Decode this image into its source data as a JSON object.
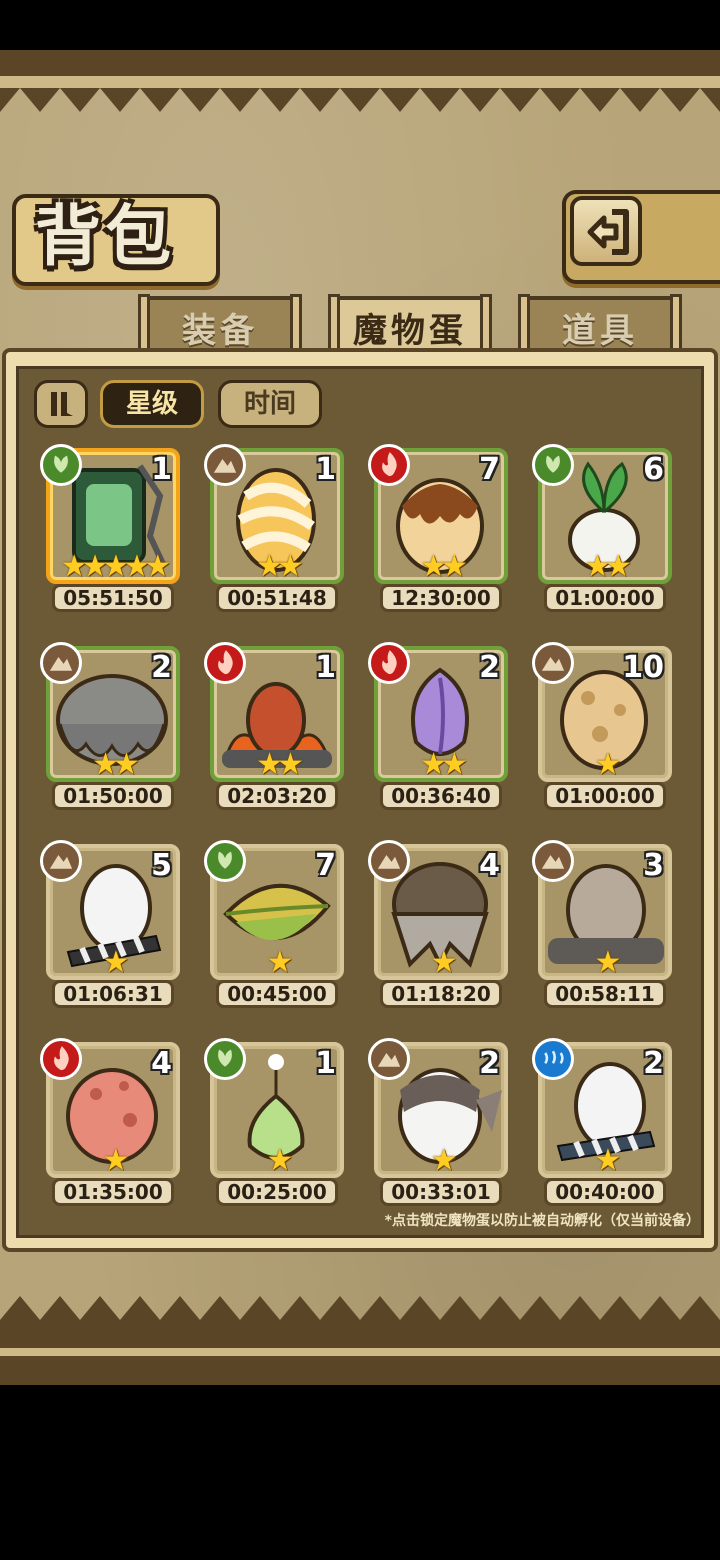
{
  "title": "背包",
  "tabs": [
    {
      "label": "装备",
      "active": false
    },
    {
      "label": "魔物蛋",
      "active": true
    },
    {
      "label": "道具",
      "active": false
    }
  ],
  "sort": {
    "toggle_icon": "pause-sort-icon",
    "star_label": "星级",
    "time_label": "时间",
    "active": "star"
  },
  "colors": {
    "grass": "#4a8a2a",
    "earth": "#7a5a3a",
    "fire": "#c41a1a",
    "water": "#1a7ad0",
    "star": "#ffcc22"
  },
  "eggs": [
    {
      "element": "grass",
      "count": "1",
      "stars": 5,
      "timer": "05:51:50",
      "art": "caged-green-egg",
      "selected": true
    },
    {
      "element": "earth",
      "count": "1",
      "stars": 2,
      "timer": "00:51:48",
      "art": "bandaged-egg"
    },
    {
      "element": "fire",
      "count": "7",
      "stars": 2,
      "timer": "12:30:00",
      "art": "caramel-slime-egg"
    },
    {
      "element": "grass",
      "count": "6",
      "stars": 2,
      "timer": "01:00:00",
      "art": "radish-egg"
    },
    {
      "element": "earth",
      "count": "2",
      "stars": 2,
      "timer": "01:50:00",
      "art": "gray-fur-egg"
    },
    {
      "element": "fire",
      "count": "1",
      "stars": 2,
      "timer": "02:03:20",
      "art": "flame-egg"
    },
    {
      "element": "fire",
      "count": "2",
      "stars": 2,
      "timer": "00:36:40",
      "art": "purple-bud-egg"
    },
    {
      "element": "earth",
      "count": "10",
      "stars": 1,
      "timer": "01:00:00",
      "art": "spotted-slime-egg",
      "plain": true
    },
    {
      "element": "earth",
      "count": "5",
      "stars": 1,
      "timer": "01:06:31",
      "art": "striped-tail-egg",
      "plain": true
    },
    {
      "element": "grass",
      "count": "7",
      "stars": 1,
      "timer": "00:45:00",
      "art": "leaf-egg",
      "plain": true
    },
    {
      "element": "earth",
      "count": "4",
      "stars": 1,
      "timer": "01:18:20",
      "art": "iron-mask-egg",
      "plain": true
    },
    {
      "element": "earth",
      "count": "3",
      "stars": 1,
      "timer": "00:58:11",
      "art": "rock-egg",
      "plain": true
    },
    {
      "element": "fire",
      "count": "4",
      "stars": 1,
      "timer": "01:35:00",
      "art": "pink-slime-egg",
      "plain": true
    },
    {
      "element": "grass",
      "count": "1",
      "stars": 1,
      "timer": "00:25:00",
      "art": "sprout-egg",
      "plain": true
    },
    {
      "element": "earth",
      "count": "2",
      "stars": 1,
      "timer": "00:33:01",
      "art": "bat-egg",
      "plain": true
    },
    {
      "element": "water",
      "count": "2",
      "stars": 1,
      "timer": "00:40:00",
      "art": "white-striped-egg",
      "plain": true
    }
  ],
  "footnote": "*点击锁定魔物蛋以防止被自动孵化（仅当前设备）"
}
